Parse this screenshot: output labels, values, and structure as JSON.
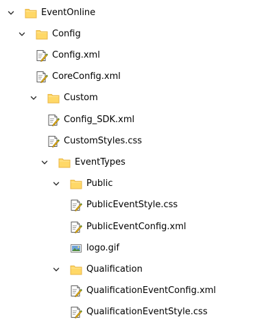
{
  "tree": [
    {
      "label": "EventOnline",
      "type": "folder",
      "expanded": true,
      "depth": 0,
      "icon": "folder-icon"
    },
    {
      "label": "Config",
      "type": "folder",
      "expanded": true,
      "depth": 1,
      "icon": "folder-icon"
    },
    {
      "label": "Config.xml",
      "type": "xml",
      "depth": 2,
      "icon": "xml-file-icon"
    },
    {
      "label": "CoreConfig.xml",
      "type": "xml",
      "depth": 2,
      "icon": "xml-file-icon"
    },
    {
      "label": "Custom",
      "type": "folder",
      "expanded": true,
      "depth": 2,
      "icon": "folder-icon"
    },
    {
      "label": "Config_SDK.xml",
      "type": "xml",
      "depth": 3,
      "icon": "xml-file-icon"
    },
    {
      "label": "CustomStyles.css",
      "type": "css",
      "depth": 3,
      "icon": "css-file-icon"
    },
    {
      "label": "EventTypes",
      "type": "folder",
      "expanded": true,
      "depth": 3,
      "icon": "folder-icon"
    },
    {
      "label": "Public",
      "type": "folder",
      "expanded": true,
      "depth": 4,
      "icon": "folder-icon"
    },
    {
      "label": "PublicEventStyle.css",
      "type": "css",
      "depth": 5,
      "icon": "css-file-icon"
    },
    {
      "label": "PublicEventConfig.xml",
      "type": "xml",
      "depth": 5,
      "icon": "xml-file-icon"
    },
    {
      "label": "logo.gif",
      "type": "image",
      "depth": 5,
      "icon": "image-file-icon"
    },
    {
      "label": "Qualification",
      "type": "folder",
      "expanded": true,
      "depth": 4,
      "icon": "folder-icon"
    },
    {
      "label": "QualificationEventConfig.xml",
      "type": "xml",
      "depth": 5,
      "icon": "xml-file-icon"
    },
    {
      "label": "QualificationEventStyle.css",
      "type": "css",
      "depth": 5,
      "icon": "css-file-icon"
    }
  ],
  "colors": {
    "folder_fill": "#FFD867",
    "folder_edge": "#E8B544",
    "chevron": "#333333",
    "doc_edge": "#5A5A5A",
    "pen_yellow": "#E8B51A",
    "pen_green": "#3F8F2F",
    "image_blue": "#6FA3D8"
  }
}
